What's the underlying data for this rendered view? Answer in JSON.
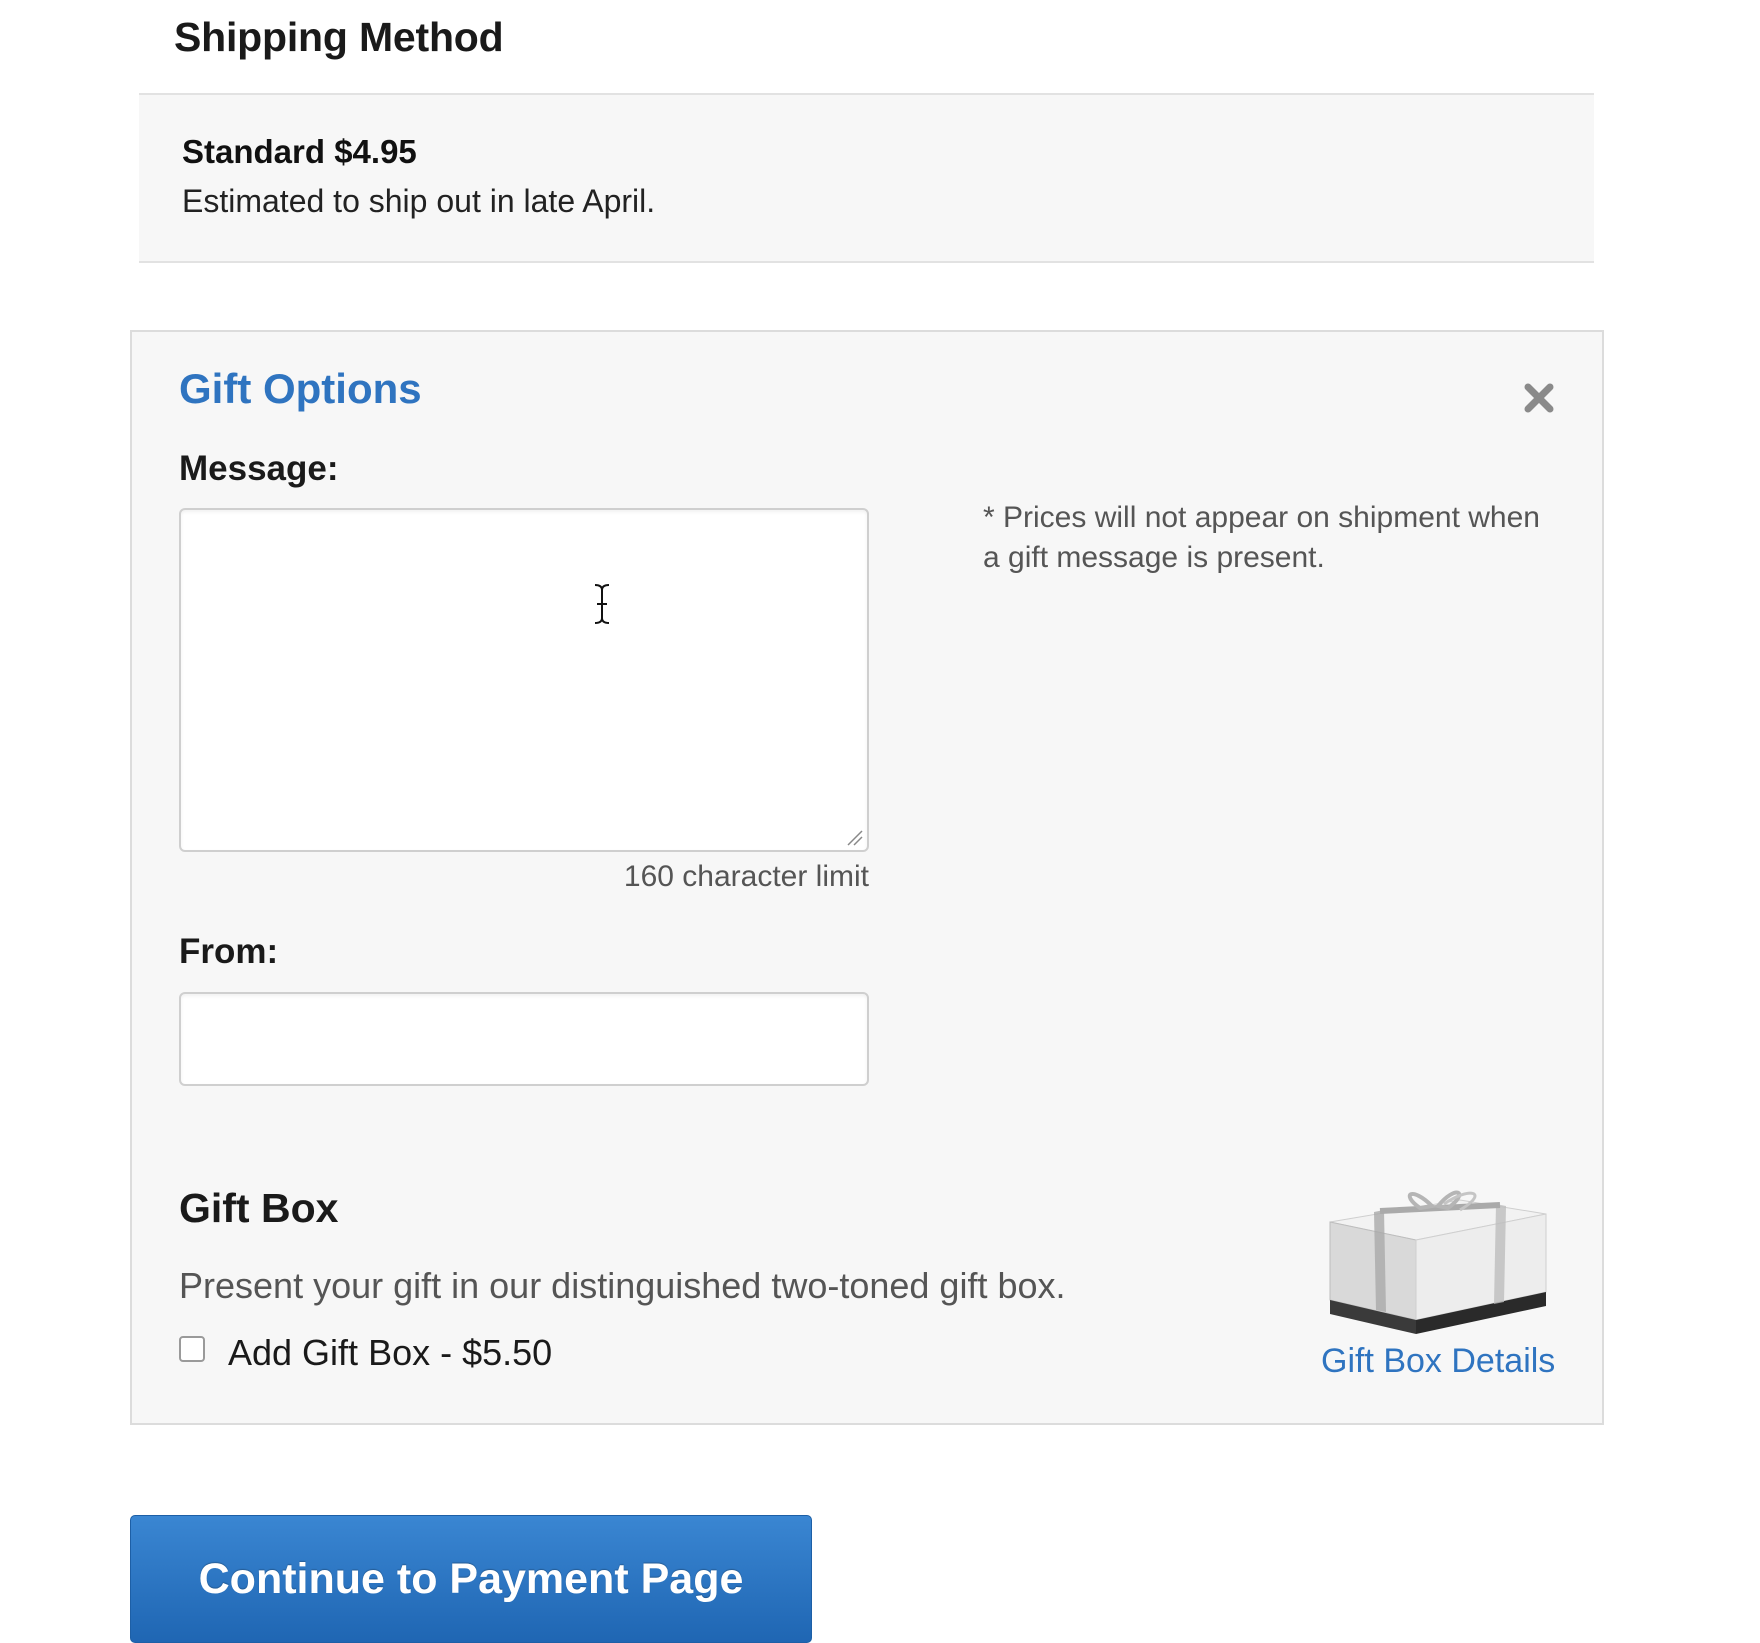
{
  "shipping": {
    "title": "Shipping Method",
    "option_name": "Standard $4.95",
    "estimate": "Estimated to ship out in late April."
  },
  "gift_options": {
    "title": "Gift Options",
    "close_icon": "close-icon",
    "message_label": "Message:",
    "message_value": "",
    "char_limit": "160 character limit",
    "from_label": "From:",
    "from_value": "",
    "prices_note": "* Prices will not appear on shipment when a gift message is present."
  },
  "gift_box": {
    "title": "Gift Box",
    "description": "Present your gift in our distinguished two-toned gift box.",
    "checkbox_label": "Add Gift Box - $5.50",
    "checked": false,
    "image_icon": "gift-box-image",
    "details_link": "Gift Box Details"
  },
  "actions": {
    "continue_label": "Continue to Payment Page"
  },
  "colors": {
    "accent": "#2f74c0",
    "button_top": "#3a86d2",
    "button_bottom": "#1f66b3",
    "panel_bg": "#f7f7f7"
  }
}
